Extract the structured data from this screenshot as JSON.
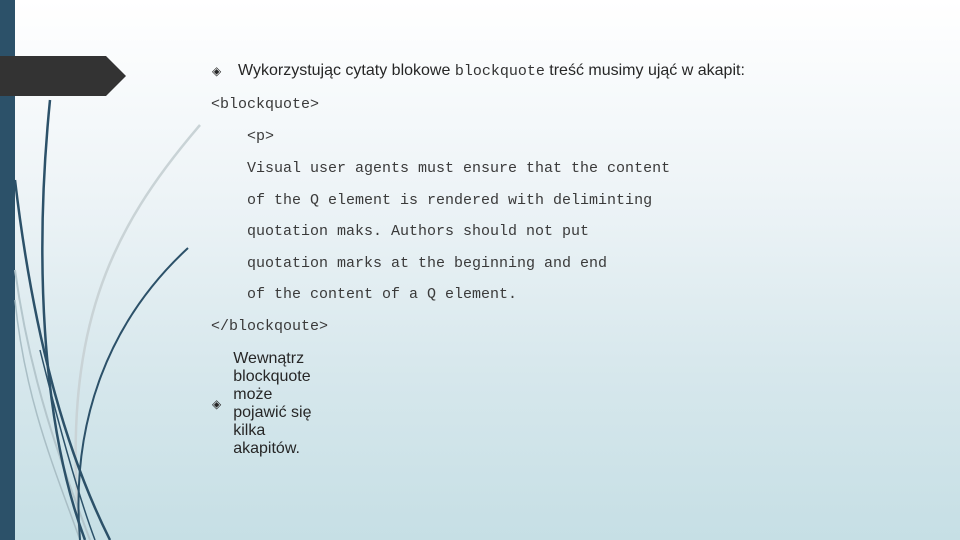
{
  "slide": {
    "bullets": [
      {
        "icon": "diamond-bullet-icon",
        "text_before": "Wykorzystując cytaty blokowe ",
        "code": "blockquote",
        "text_after": " treść musimy ująć w akapit:"
      },
      {
        "icon": "diamond-bullet-icon",
        "text": "Wewnątrz blockquote może pojawić się kilka akapitów."
      }
    ],
    "code_block": {
      "open_tag": "<blockquote>",
      "p_tag": "<p>",
      "lines": [
        "Visual user agents must ensure that the content",
        "of the Q element is rendered with deliminting",
        "quotation maks. Authors should not put",
        "quotation marks at the beginning and end",
        "of the content of a Q element."
      ],
      "close_tag": "</blockqoute>"
    }
  },
  "colors": {
    "side_bar": "#2c5169",
    "arrow_tab": "#333333",
    "text": "#262626"
  }
}
